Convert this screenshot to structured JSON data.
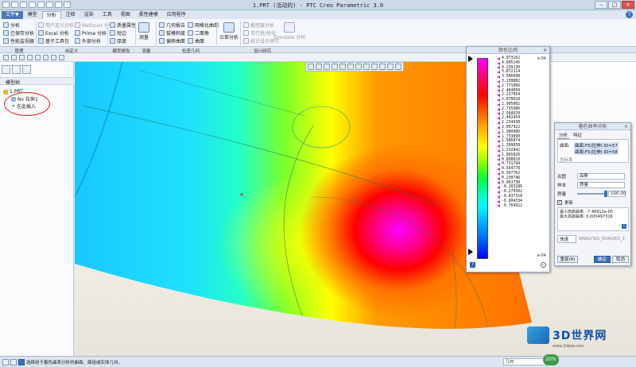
{
  "window": {
    "title": "1.PRT (活动的) - PTC Creo Parametric 3.0",
    "controls": [
      "–",
      "□",
      "×"
    ]
  },
  "tabs": [
    {
      "label": "文件▼",
      "kind": "file"
    },
    {
      "label": "模型"
    },
    {
      "label": "分析",
      "active": true
    },
    {
      "label": "注释"
    },
    {
      "label": "渲染"
    },
    {
      "label": "工具"
    },
    {
      "label": "视图"
    },
    {
      "label": "柔性建模"
    },
    {
      "label": "应用程序"
    }
  ],
  "ribbon": {
    "items": {
      "analysis": "分析",
      "saved_analysis": "已保存分析",
      "constraint": "性能监视器",
      "user_defined": "用户定义分析",
      "excel": "Excel 分析",
      "custom_tool": "基于工具包",
      "mathcad": "Mathcad 分析",
      "prime": "Prime 分析",
      "external": "外部分析",
      "mass": "质量属性",
      "short_edge": "短边",
      "thickness": "厚度",
      "measure": "测量",
      "geometry_report": "几何报告",
      "draft": "拔模斜度",
      "mesh": "偏移曲面",
      "curvature": "网格化曲面",
      "dihedral": "二面角",
      "surface": "曲面",
      "check_geo": "公差分析",
      "sensitivity": "敏感度分析",
      "feasibility": "可行性/优化",
      "statistical": "统计设计研究",
      "simulate": "Simulate 分析"
    },
    "groups": {
      "manage": "管理",
      "custom": "自定义",
      "model_report": "模型报告",
      "measure": "测量",
      "inspect_geometry": "检查几何",
      "design_study": "设计研究"
    }
  },
  "model_tree": {
    "header": "模型树",
    "items": [
      {
        "label": "1.PRT"
      },
      {
        "label": "Nx 拉伸1"
      },
      {
        "label": "在此插入"
      }
    ]
  },
  "color_scale": {
    "title": "颜色比例",
    "unit_top": "e-04",
    "unit_bottom": "e-04",
    "max": 4.973162,
    "min": -0.769912,
    "labels": [
      "4.973162",
      "4.605145",
      "4.239130",
      "3.872114",
      "3.506098",
      "3.138082",
      "2.771066",
      "2.404050",
      "2.237054",
      "2.070018",
      "2.905002",
      "2.735986",
      "2.568970",
      "2.401954",
      "2.234938",
      "2.067922",
      "1.900906",
      "1.733890",
      "1.566874",
      "1.399858",
      "1.232842",
      "1.065826",
      "0.898810",
      "0.731794",
      "0.564778",
      "0.397762",
      "0.230746",
      "0.063730",
      "-0.103286",
      "-0.270302",
      "-0.437318",
      "-0.604334",
      "-0.769912"
    ]
  },
  "dialog": {
    "title": "着色曲率分析",
    "tabs": [
      "分析",
      "特征"
    ],
    "surface_label": "曲面:",
    "surfaces": [
      "曲面:F5(拉伸) ID=57",
      "曲面:F5(拉伸) ID=58"
    ],
    "coord_label": "坐标系",
    "output_label": "出图",
    "output_value": "高斯",
    "sample_label": "样本",
    "sample_value": "质量",
    "quality_label": "质量",
    "quality_value": "100.00",
    "update_label": "更新",
    "result_max_label": "最小高斯曲率:",
    "result_max_value": "-7.46912e-05",
    "result_min_label": "最大高斯曲率:",
    "result_min_value": "0.000497316",
    "saved_label": "快速",
    "saved_value": "ANALYSIS_SHADED_1",
    "buttons": {
      "repeat": "重复(R)",
      "ok": "确定",
      "cancel": "取消"
    }
  },
  "status_bar": {
    "message": "选择用于着色曲率分析的曲面、面组或实体几何。",
    "filter": "几何",
    "zoom_badge": "20%"
  },
  "watermark": {
    "name": "3D世界网",
    "site": "www.3dsjw.com"
  }
}
